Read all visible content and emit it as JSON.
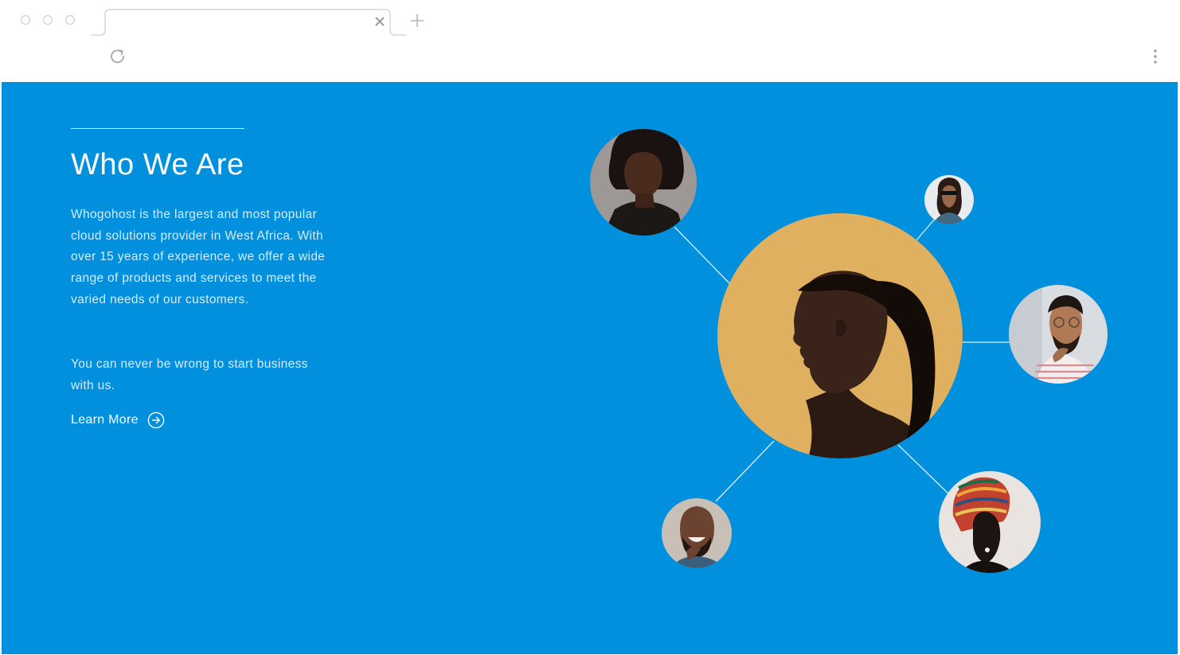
{
  "browser": {
    "window_controls": [
      "close",
      "minimize",
      "maximize"
    ],
    "tab_title": "",
    "icons": {
      "tab_close": "close-icon",
      "new_tab": "plus-icon",
      "reload": "reload-icon",
      "menu": "kebab-menu-icon"
    }
  },
  "section": {
    "title": "Who We Are",
    "paragraph_1": "Whogohost is the largest and most popular cloud solutions provider in West Africa. With over 15 years of experience, we offer a wide range of products and services to meet the varied needs of our customers.",
    "paragraph_2": "You can never be wrong to start business with us.",
    "cta_label": "Learn More",
    "cta_icon": "arrow-right-circle-icon"
  },
  "colors": {
    "panel_bg": "#0090de",
    "text_primary": "#ffffff",
    "text_secondary": "#d6ecfa",
    "center_photo_bg": "#dcae5e"
  },
  "people_network": {
    "center": "profile-photo-woman-ponytail",
    "satellites": [
      "photo-woman-afro",
      "photo-man-sunglasses",
      "photo-man-glasses-striped-shirt",
      "photo-woman-headwrap",
      "photo-man-laughing"
    ]
  }
}
